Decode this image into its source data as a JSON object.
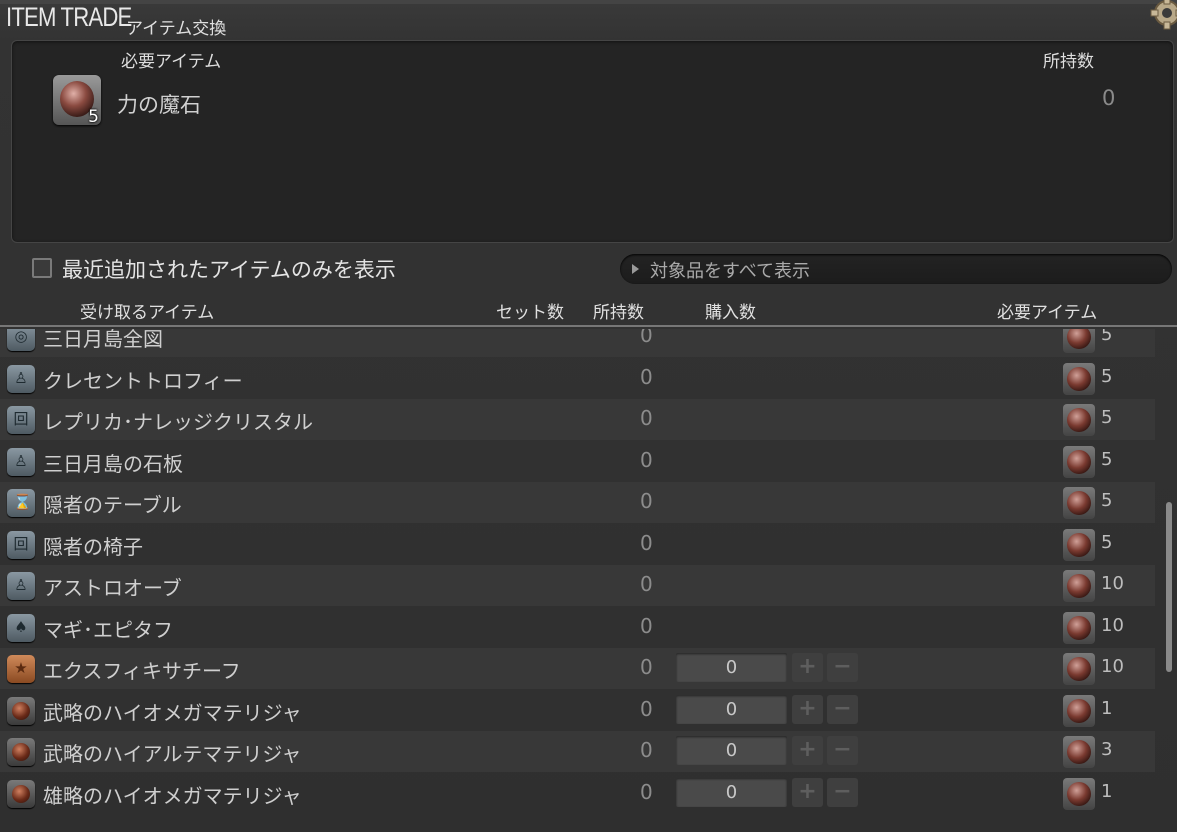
{
  "window": {
    "title": "ITEM TRADE",
    "subtitle": "アイテム交換",
    "close_icon": "gear-close-icon"
  },
  "required": {
    "header_item": "必要アイテム",
    "header_owned": "所持数",
    "item_name": "力の魔石",
    "item_count": "5",
    "owned": "0"
  },
  "filter": {
    "checkbox_label": "最近追加されたアイテムのみを表示",
    "checked": false,
    "show_all_label": "対象品をすべて表示"
  },
  "columns": {
    "receive": "受け取るアイテム",
    "set_count": "セット数",
    "owned": "所持数",
    "purchase": "購入数",
    "required": "必要アイテム"
  },
  "rows": [
    {
      "name": "三日月島全図",
      "owned": "0",
      "cost": "5",
      "icon": "map-icon",
      "has_qty": false
    },
    {
      "name": "クレセントトロフィー",
      "owned": "0",
      "cost": "5",
      "icon": "furnishing-icon",
      "has_qty": false
    },
    {
      "name": "レプリカ･ナレッジクリスタル",
      "owned": "0",
      "cost": "5",
      "icon": "wall-mount-icon",
      "has_qty": false
    },
    {
      "name": "三日月島の石板",
      "owned": "0",
      "cost": "5",
      "icon": "furnishing-icon",
      "has_qty": false
    },
    {
      "name": "隠者のテーブル",
      "owned": "0",
      "cost": "5",
      "icon": "table-icon",
      "has_qty": false
    },
    {
      "name": "隠者の椅子",
      "owned": "0",
      "cost": "5",
      "icon": "wall-mount-icon",
      "has_qty": false
    },
    {
      "name": "アストロオーブ",
      "owned": "0",
      "cost": "10",
      "icon": "furnishing-icon",
      "has_qty": false
    },
    {
      "name": "マギ･エピタフ",
      "owned": "0",
      "cost": "10",
      "icon": "outdoor-icon",
      "has_qty": false
    },
    {
      "name": "エクスフィキサチーフ",
      "owned": "0",
      "cost": "10",
      "icon": "star-icon",
      "has_qty": true,
      "qty": "0"
    },
    {
      "name": "武略のハイオメガマテリジャ",
      "owned": "0",
      "cost": "1",
      "icon": "materia-icon",
      "has_qty": true,
      "qty": "0"
    },
    {
      "name": "武略のハイアルテマテリジャ",
      "owned": "0",
      "cost": "3",
      "icon": "materia-icon",
      "has_qty": true,
      "qty": "0"
    },
    {
      "name": "雄略のハイオメガマテリジャ",
      "owned": "0",
      "cost": "1",
      "icon": "materia-icon",
      "has_qty": true,
      "qty": "0"
    }
  ],
  "qty_controls": {
    "plus": "+",
    "minus": "−"
  },
  "glyphs": {
    "map-icon": "◎",
    "furnishing-icon": "♙",
    "wall-mount-icon": "回",
    "table-icon": "⌛",
    "outdoor-icon": "♠",
    "star-icon": "★",
    "materia-icon": ""
  }
}
